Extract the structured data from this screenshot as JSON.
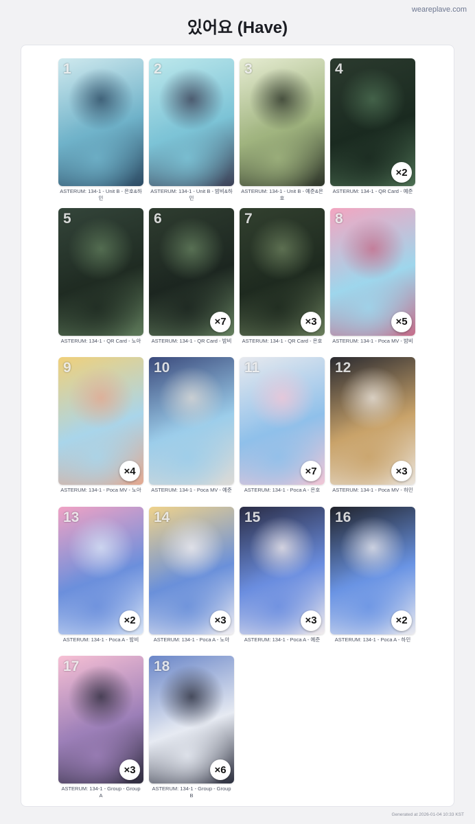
{
  "site": "weareplave.com",
  "title": "있어요 (Have)",
  "footer": "Generated at 2026-01-04 10:33 KST",
  "cards": [
    {
      "number": "1",
      "caption": "ASTERUM: 134-1 - Unit B - 은호&하민",
      "qty": "",
      "colors": [
        "#cfe9ee",
        "#6fb2c9",
        "#2c4a63"
      ]
    },
    {
      "number": "2",
      "caption": "ASTERUM: 134-1 - Unit B - 밤비&하민",
      "qty": "",
      "colors": [
        "#bde8ec",
        "#7cc3d6",
        "#3b3f55"
      ]
    },
    {
      "number": "3",
      "caption": "ASTERUM: 134-1 - Unit B - 예준&은호",
      "qty": "",
      "colors": [
        "#e6ecd2",
        "#9fb37e",
        "#2c3328"
      ]
    },
    {
      "number": "4",
      "caption": "ASTERUM: 134-1 - QR Card - 예준",
      "qty": "×2",
      "colors": [
        "#2b3a2e",
        "#1a2a20",
        "#4c6e52"
      ]
    },
    {
      "number": "5",
      "caption": "ASTERUM: 134-1 - QR Card - 노아",
      "qty": "",
      "colors": [
        "#34453a",
        "#1f2b22",
        "#5e7a5a"
      ]
    },
    {
      "number": "6",
      "caption": "ASTERUM: 134-1 - QR Card - 밤비",
      "qty": "×7",
      "colors": [
        "#2f3d30",
        "#1c2620",
        "#65805f"
      ]
    },
    {
      "number": "7",
      "caption": "ASTERUM: 134-1 - QR Card - 은호",
      "qty": "×3",
      "colors": [
        "#32402f",
        "#1e2a1f",
        "#6a7e5c"
      ]
    },
    {
      "number": "8",
      "caption": "ASTERUM: 134-1 - Poca MV - 밤비",
      "qty": "×5",
      "colors": [
        "#f3a5c0",
        "#9ed6ec",
        "#c56d8a"
      ]
    },
    {
      "number": "9",
      "caption": "ASTERUM: 134-1 - Poca MV - 노아",
      "qty": "×4",
      "colors": [
        "#f0d07a",
        "#a9d5ea",
        "#e3a890"
      ]
    },
    {
      "number": "10",
      "caption": "ASTERUM: 134-1 - Poca MV - 예준",
      "qty": "",
      "colors": [
        "#3b4a7c",
        "#9ccdea",
        "#dcdad6"
      ]
    },
    {
      "number": "11",
      "caption": "ASTERUM: 134-1 - Poca A - 은호",
      "qty": "×7",
      "colors": [
        "#e7e9ee",
        "#8fc0ea",
        "#f1c6d6"
      ]
    },
    {
      "number": "12",
      "caption": "ASTERUM: 134-1 - Poca MV - 하민",
      "qty": "×3",
      "colors": [
        "#2a2a30",
        "#c9a36a",
        "#eae4dc"
      ]
    },
    {
      "number": "13",
      "caption": "ASTERUM: 134-1 - Poca A - 밤비",
      "qty": "×2",
      "colors": [
        "#f0a2c4",
        "#6b8fdc",
        "#d8e4f6"
      ]
    },
    {
      "number": "14",
      "caption": "ASTERUM: 134-1 - Poca A - 노아",
      "qty": "×3",
      "colors": [
        "#efd28a",
        "#6a90da",
        "#f0eef2"
      ]
    },
    {
      "number": "15",
      "caption": "ASTERUM: 134-1 - Poca A - 예준",
      "qty": "×3",
      "colors": [
        "#2a2c45",
        "#6b8ee0",
        "#f1ebec"
      ]
    },
    {
      "number": "16",
      "caption": "ASTERUM: 134-1 - Poca A - 하민",
      "qty": "×2",
      "colors": [
        "#20222a",
        "#6a94e4",
        "#e9e9ef"
      ]
    },
    {
      "number": "17",
      "caption": "ASTERUM: 134-1 - Group - Group A",
      "qty": "×3",
      "colors": [
        "#f7c0d4",
        "#9c7fb8",
        "#2d2b3c"
      ]
    },
    {
      "number": "18",
      "caption": "ASTERUM: 134-1 - Group - Group B",
      "qty": "×6",
      "colors": [
        "#6a86c8",
        "#e6eaf2",
        "#2a2d3c"
      ]
    }
  ]
}
